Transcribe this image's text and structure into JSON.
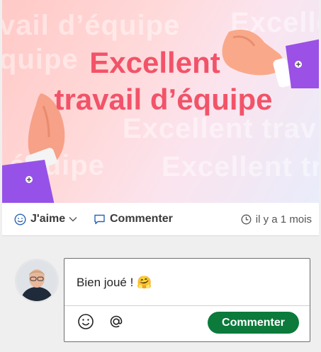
{
  "banner": {
    "title_line1": "Excellent",
    "title_line2": "travail d’équipe",
    "bg_words": [
      "vail d’équipe",
      "Excelle",
      "quipe",
      "Excellent trav",
      "équipe",
      "Excellent tr"
    ]
  },
  "actions": {
    "like_label": "J'aime",
    "comment_label": "Commenter",
    "timestamp": "il y a 1 mois"
  },
  "composer": {
    "text": "Bien joué ! 🤗",
    "submit_label": "Commenter"
  },
  "colors": {
    "accent_pink": "#f25369",
    "submit_green": "#0b7a3b",
    "link_blue": "#2b63b6"
  }
}
